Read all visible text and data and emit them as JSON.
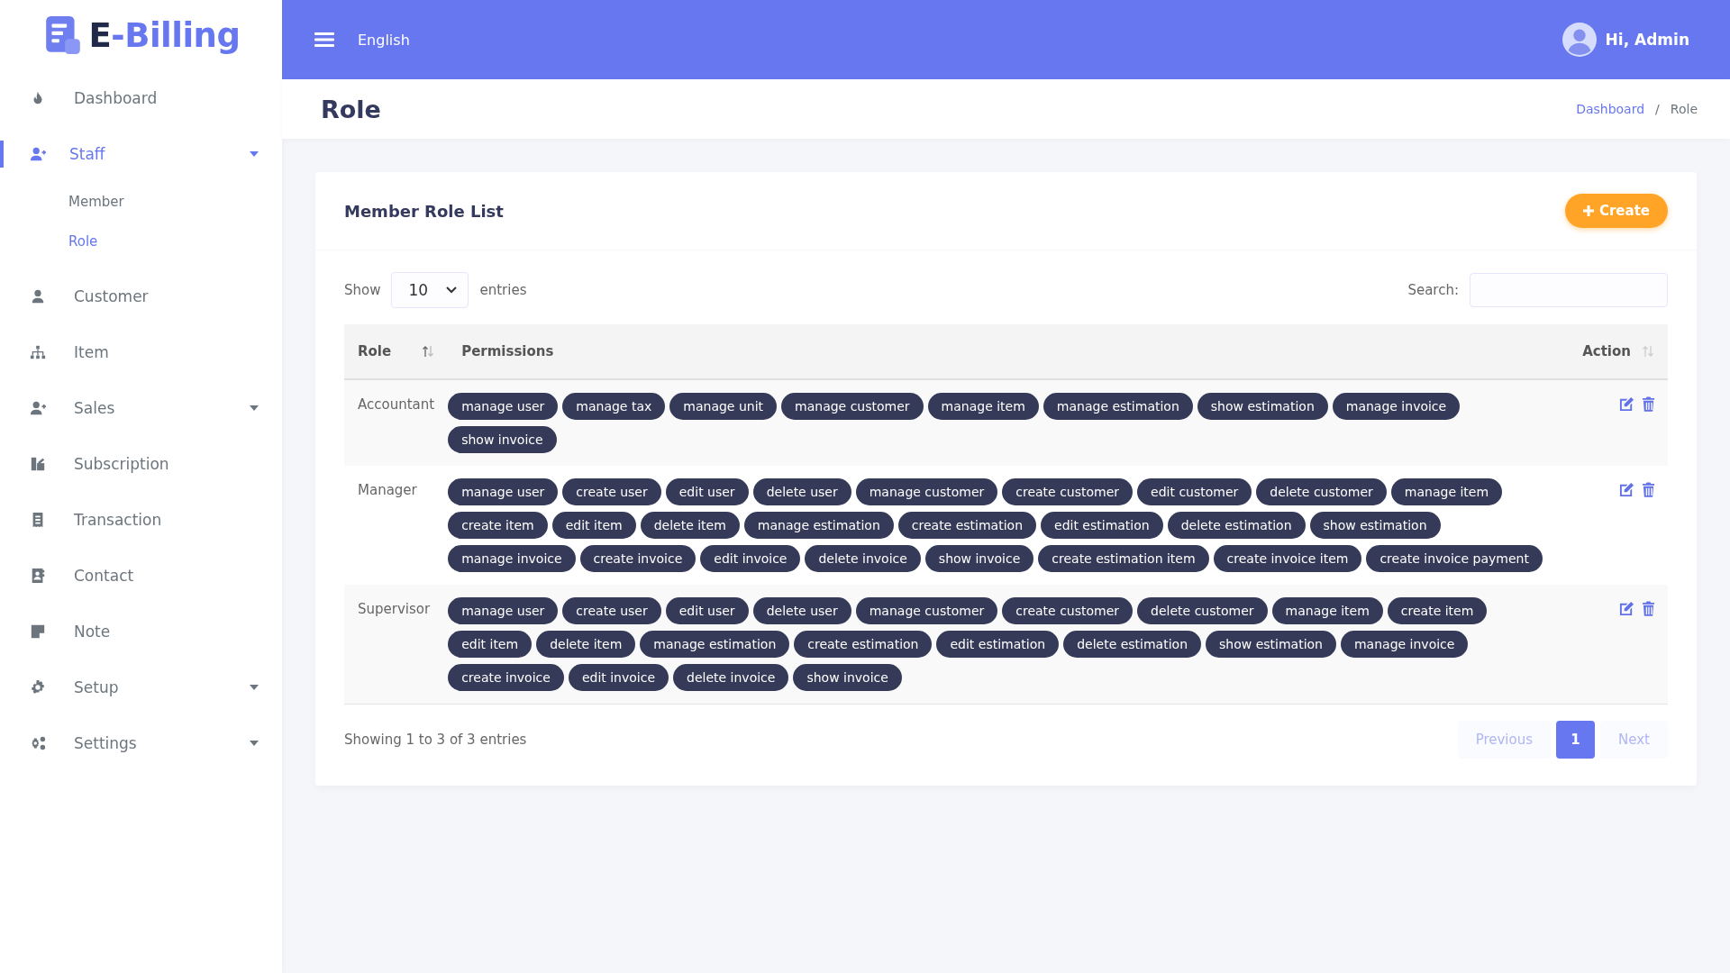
{
  "logo": {
    "text": "E-Billing"
  },
  "sidebar": {
    "items": [
      {
        "label": "Dashboard",
        "selected": false,
        "expandable": false
      },
      {
        "label": "Staff",
        "selected": true,
        "expandable": true,
        "children": [
          {
            "label": "Member",
            "selected": false
          },
          {
            "label": "Role",
            "selected": true
          }
        ]
      },
      {
        "label": "Customer",
        "selected": false,
        "expandable": false
      },
      {
        "label": "Item",
        "selected": false,
        "expandable": false
      },
      {
        "label": "Sales",
        "selected": false,
        "expandable": true
      },
      {
        "label": "Subscription",
        "selected": false,
        "expandable": false
      },
      {
        "label": "Transaction",
        "selected": false,
        "expandable": false
      },
      {
        "label": "Contact",
        "selected": false,
        "expandable": false
      },
      {
        "label": "Note",
        "selected": false,
        "expandable": false
      },
      {
        "label": "Setup",
        "selected": false,
        "expandable": true
      },
      {
        "label": "Settings",
        "selected": false,
        "expandable": true
      }
    ]
  },
  "topbar": {
    "language": "English",
    "user": "Hi, Admin"
  },
  "page": {
    "title": "Role",
    "breadcrumb": [
      {
        "label": "Dashboard",
        "link": true
      },
      {
        "label": "/",
        "link": false
      },
      {
        "label": "Role",
        "link": false
      }
    ]
  },
  "card": {
    "title": "Member Role List",
    "create_button": "Create",
    "length_label": "Show",
    "length_value": "10",
    "length_suffix": "entries",
    "search_label": "Search:",
    "table": {
      "columns": [
        "Role",
        "Permissions",
        "Action"
      ],
      "rows": [
        {
          "role": "Accountant",
          "permissions": [
            "manage user",
            "manage tax",
            "manage unit",
            "manage customer",
            "manage item",
            "manage estimation",
            "show estimation",
            "manage invoice",
            "show invoice"
          ]
        },
        {
          "role": "Manager",
          "permissions": [
            "manage user",
            "create user",
            "edit user",
            "delete user",
            "manage customer",
            "create customer",
            "edit customer",
            "delete customer",
            "manage item",
            "create item",
            "edit item",
            "delete item",
            "manage estimation",
            "create estimation",
            "edit estimation",
            "delete estimation",
            "show estimation",
            "manage invoice",
            "create invoice",
            "edit invoice",
            "delete invoice",
            "show invoice",
            "create estimation item",
            "create invoice item",
            "create invoice payment"
          ]
        },
        {
          "role": "Supervisor",
          "permissions": [
            "manage user",
            "create user",
            "edit user",
            "delete user",
            "manage customer",
            "create customer",
            "delete customer",
            "manage item",
            "create item",
            "edit item",
            "delete item",
            "manage estimation",
            "create estimation",
            "edit estimation",
            "delete estimation",
            "show estimation",
            "manage invoice",
            "create invoice",
            "edit invoice",
            "delete invoice",
            "show invoice"
          ]
        }
      ]
    },
    "info": "Showing 1 to 3 of 3 entries",
    "pagination": [
      {
        "label": "Previous",
        "kind": "nav",
        "selected": false
      },
      {
        "label": "1",
        "kind": "page",
        "selected": true
      },
      {
        "label": "Next",
        "kind": "nav",
        "selected": false
      }
    ]
  }
}
